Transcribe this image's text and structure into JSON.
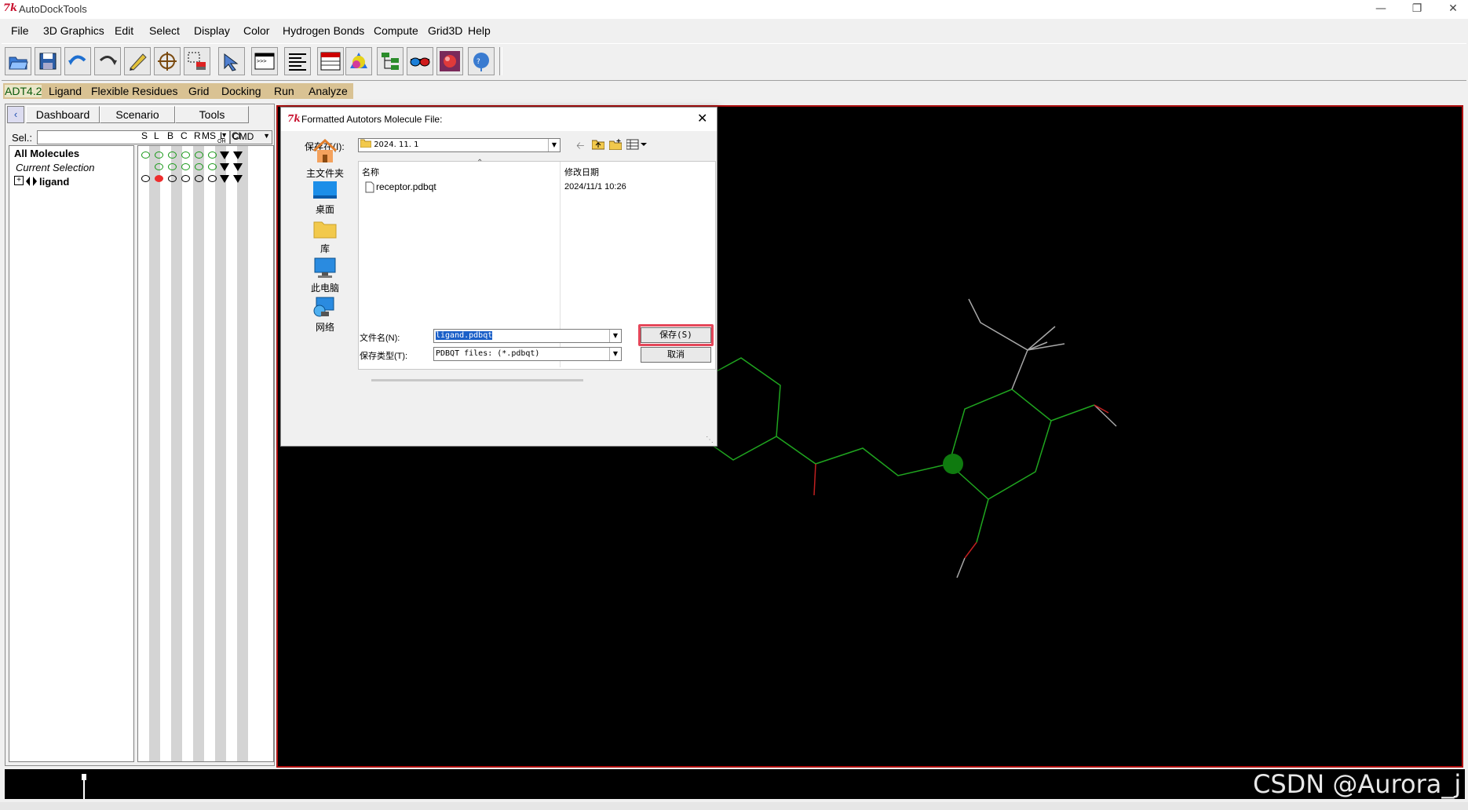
{
  "window": {
    "title": "AutoDockTools"
  },
  "menubar": [
    "File",
    "3D Graphics",
    "Edit",
    "Select",
    "Display",
    "Color",
    "Hydrogen Bonds",
    "Compute",
    "Grid3D",
    "Help"
  ],
  "toolbar_icons": [
    "open-folder-icon",
    "save-disk-icon",
    "undo-icon",
    "redo-icon",
    "pencil-icon",
    "crosshair-icon",
    "selection-icon",
    "pointer-icon",
    "python-shell-icon",
    "text-align-icon",
    "spreadsheet-icon",
    "color-ball-icon",
    "hierarchy-icon",
    "stereo-glasses-icon",
    "rendering-icon",
    "help-icon"
  ],
  "modules": [
    "ADT4.2",
    "Ligand",
    "Flexible Residues",
    "Grid",
    "Docking",
    "Run",
    "Analyze"
  ],
  "dashboard": {
    "tabs": [
      "Dashboard",
      "Scenario",
      "Tools"
    ],
    "sel_label": "Sel.:",
    "sel_value": "",
    "cmd_label": "CMD",
    "columns": [
      "S",
      "L",
      "B",
      "C",
      "R",
      "MS",
      "L",
      "Cl"
    ],
    "col_sub": [
      "OH"
    ],
    "rows": [
      {
        "label": "All Molecules",
        "style": "bold"
      },
      {
        "label": "Current Selection",
        "style": "italic"
      },
      {
        "label": "ligand",
        "style": "bold"
      }
    ]
  },
  "dialog": {
    "title": "Formatted Autotors Molecule File:",
    "save_in_label": "保存在(I):",
    "folder": "2024. 11. 1",
    "places": [
      "主文件夹",
      "桌面",
      "库",
      "此电脑",
      "网络"
    ],
    "columns": {
      "name": "名称",
      "modified": "修改日期"
    },
    "files": [
      {
        "name": "receptor.pdbqt",
        "modified": "2024/11/1 10:26"
      }
    ],
    "filename_label": "文件名(N):",
    "filename_value": "ligand.pdbqt",
    "filetype_label": "保存类型(T):",
    "filetype_value": "PDBQT files: (*.pdbqt)",
    "save_button": "保存(S)",
    "cancel_button": "取消"
  },
  "watermark": "CSDN @Aurora_j",
  "colors": {
    "module_bar": "#d9c293",
    "viewer_border": "#b01010",
    "bond_green": "#1fa51f",
    "atom_green": "#0f7a0f",
    "highlight": "#e5475a"
  }
}
